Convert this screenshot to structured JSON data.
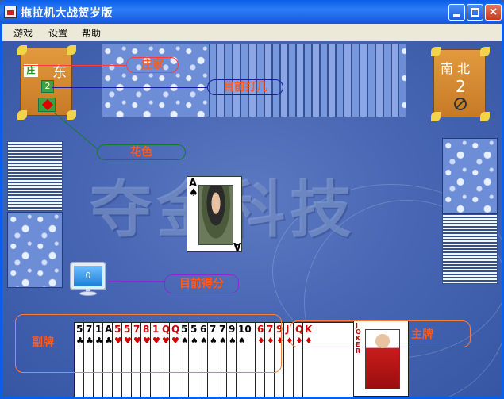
{
  "window": {
    "title": "拖拉机大战贺岁版",
    "buttons": {
      "close": "×"
    }
  },
  "menu": {
    "items": [
      "游戏",
      "设置",
      "帮助"
    ]
  },
  "watermark": "夺金科技",
  "left_panel": {
    "dealer_badge": "庄",
    "seat": "东",
    "current_rank": "2",
    "trump_suit": "diamond"
  },
  "right_panel": {
    "seats": "南 北",
    "level": "2",
    "status_icon": "prohibit-icon"
  },
  "annotations": {
    "dealer": "庄家",
    "current_level": "目前打几",
    "suit": "花色",
    "current_score": "目前得分",
    "side_cards": "副牌",
    "trump_cards": "主牌"
  },
  "score": "0",
  "center_card": {
    "rank": "A",
    "suit": "♠"
  },
  "hand": {
    "cards": [
      {
        "rank": "5",
        "suit": "♣",
        "color": "black"
      },
      {
        "rank": "7",
        "suit": "♣",
        "color": "black"
      },
      {
        "rank": "10",
        "suit": "♣",
        "color": "black"
      },
      {
        "rank": "A",
        "suit": "♣",
        "color": "black"
      },
      {
        "rank": "5",
        "suit": "♥",
        "color": "red"
      },
      {
        "rank": "5",
        "suit": "♥",
        "color": "red"
      },
      {
        "rank": "7",
        "suit": "♥",
        "color": "red"
      },
      {
        "rank": "8",
        "suit": "♥",
        "color": "red"
      },
      {
        "rank": "10",
        "suit": "♥",
        "color": "red"
      },
      {
        "rank": "Q",
        "suit": "♥",
        "color": "red"
      },
      {
        "rank": "Q",
        "suit": "♥",
        "color": "red"
      },
      {
        "rank": "5",
        "suit": "♠",
        "color": "black"
      },
      {
        "rank": "5",
        "suit": "♠",
        "color": "black"
      },
      {
        "rank": "6",
        "suit": "♠",
        "color": "black"
      },
      {
        "rank": "7",
        "suit": "♠",
        "color": "black"
      },
      {
        "rank": "7",
        "suit": "♠",
        "color": "black"
      },
      {
        "rank": "9",
        "suit": "♠",
        "color": "black"
      },
      {
        "rank": "10",
        "suit": "♠",
        "color": "black"
      },
      {
        "rank": "6",
        "suit": "♦",
        "color": "red"
      },
      {
        "rank": "7",
        "suit": "♦",
        "color": "red"
      },
      {
        "rank": "9",
        "suit": "♦",
        "color": "red"
      },
      {
        "rank": "J",
        "suit": "♦",
        "color": "red"
      },
      {
        "rank": "Q",
        "suit": "♦",
        "color": "red"
      },
      {
        "rank": "K",
        "suit": "♦",
        "color": "red"
      }
    ],
    "joker_label": "JOKER"
  }
}
